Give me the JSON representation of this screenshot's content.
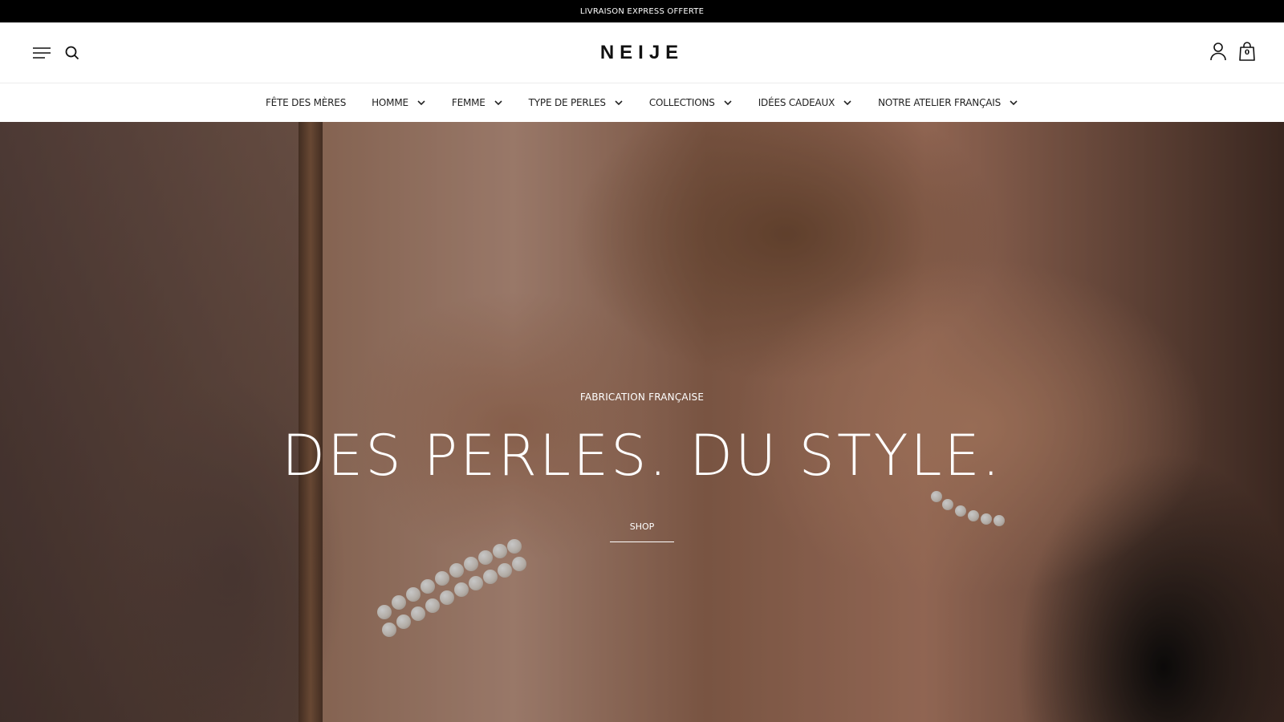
{
  "announcement": {
    "text": "LIVRAISON EXPRESS OFFERTE"
  },
  "header": {
    "logo": "NEIJE",
    "cart_count": "0",
    "icons": {
      "menu": "hamburger-menu-icon",
      "search": "search-icon",
      "account": "user-account-icon",
      "cart": "shopping-bag-icon"
    }
  },
  "nav": {
    "items": [
      {
        "label": "FÊTE DES MÈRES",
        "has_dropdown": false
      },
      {
        "label": "HOMME",
        "has_dropdown": true
      },
      {
        "label": "FEMME",
        "has_dropdown": true
      },
      {
        "label": "TYPE DE PERLES",
        "has_dropdown": true
      },
      {
        "label": "COLLECTIONS",
        "has_dropdown": true
      },
      {
        "label": "IDÉES CADEAUX",
        "has_dropdown": true
      },
      {
        "label": "NOTRE ATELIER FRANÇAIS",
        "has_dropdown": true
      }
    ]
  },
  "hero": {
    "eyebrow": "FABRICATION FRANÇAISE",
    "title": "DES PERLES. DU STYLE.",
    "cta": "SHOP"
  },
  "colors": {
    "announcement_bg": "#000000",
    "text_dark": "#111111",
    "hero_text": "#ffffff"
  }
}
